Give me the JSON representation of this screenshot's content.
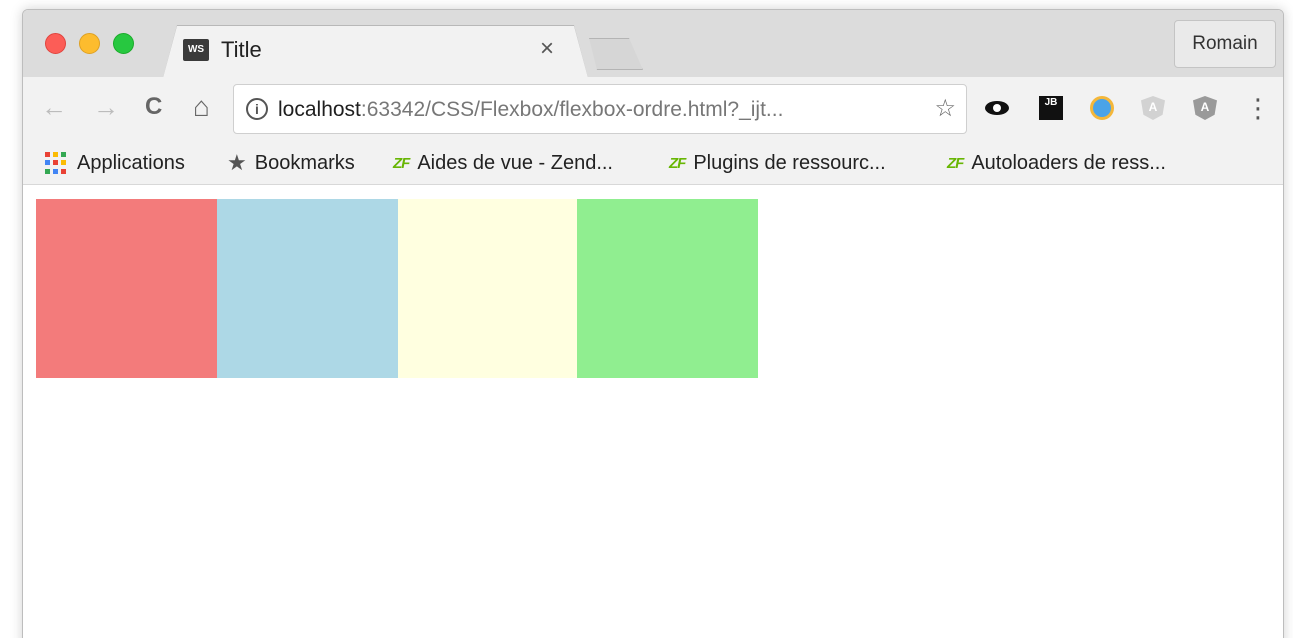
{
  "window": {
    "tab": {
      "favicon_text": "WS",
      "title": "Title",
      "close_glyph": "×"
    },
    "profile_label": "Romain"
  },
  "toolbar": {
    "back_glyph": "←",
    "forward_glyph": "→",
    "reload_glyph": "C",
    "home_glyph": "⌂",
    "url_host": "localhost",
    "url_rest": ":63342/CSS/Flexbox/flexbox-ordre.html?_ijt...",
    "star_glyph": "☆",
    "menu_glyph": "⋮",
    "extensions": [
      "eye-icon",
      "jetbrains-icon",
      "clock-icon",
      "angular-shield-light-icon",
      "angular-shield-dark-icon"
    ],
    "ext_jb_text": "JB",
    "ext_shield_letter": "A"
  },
  "bookmarks": [
    {
      "label": "Applications",
      "icon": "apps-grid-icon"
    },
    {
      "label": "Bookmarks",
      "icon": "star-icon"
    },
    {
      "label": "Aides de vue - Zend...",
      "icon": "zf-icon"
    },
    {
      "label": "Plugins de ressourc...",
      "icon": "zf-icon"
    },
    {
      "label": "Autoloaders de ress...",
      "icon": "zf-icon"
    }
  ],
  "zf_text": "ZF",
  "bookmark_star_glyph": "★",
  "apps_colors": [
    "#e94235",
    "#fbbc04",
    "#34a853",
    "#4285f4",
    "#e94235",
    "#fbbc04",
    "#34a853",
    "#4285f4",
    "#e94235"
  ],
  "flex_items": [
    {
      "name": "red",
      "color": "#f37b7b"
    },
    {
      "name": "blue",
      "color": "#add8e6"
    },
    {
      "name": "yellow",
      "color": "#ffffe0"
    },
    {
      "name": "green",
      "color": "#90ee90"
    }
  ]
}
